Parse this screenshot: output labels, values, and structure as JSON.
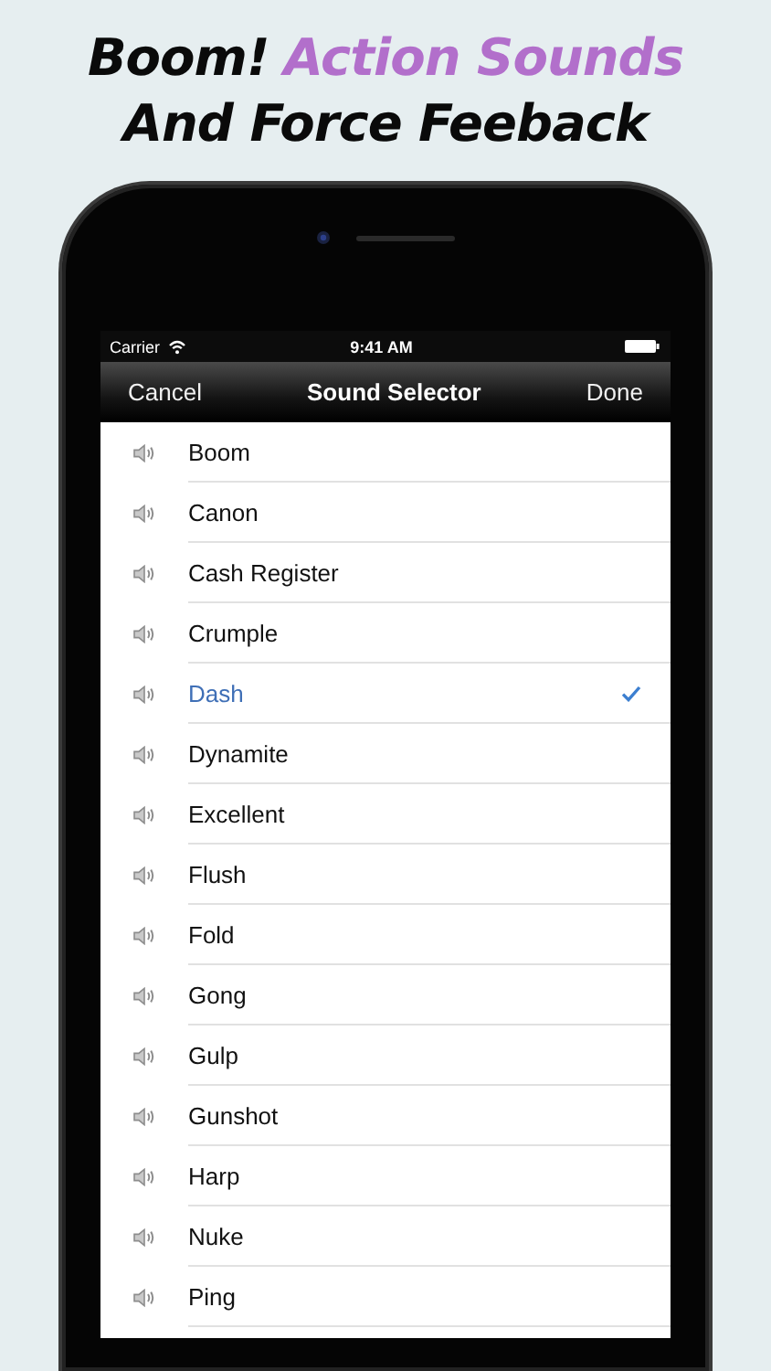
{
  "headline": [
    [
      {
        "text": "Boom!",
        "accent": false
      },
      {
        "text": "Action Sounds",
        "accent": true
      }
    ],
    [
      {
        "text": "And Force Feeback",
        "accent": false
      }
    ]
  ],
  "status_bar": {
    "carrier": "Carrier",
    "time": "9:41 AM"
  },
  "nav_bar": {
    "left": "Cancel",
    "title": "Sound Selector",
    "right": "Done"
  },
  "sounds": [
    {
      "name": "Boom",
      "selected": false
    },
    {
      "name": "Canon",
      "selected": false
    },
    {
      "name": "Cash Register",
      "selected": false
    },
    {
      "name": "Crumple",
      "selected": false
    },
    {
      "name": "Dash",
      "selected": true
    },
    {
      "name": "Dynamite",
      "selected": false
    },
    {
      "name": "Excellent",
      "selected": false
    },
    {
      "name": "Flush",
      "selected": false
    },
    {
      "name": "Fold",
      "selected": false
    },
    {
      "name": "Gong",
      "selected": false
    },
    {
      "name": "Gulp",
      "selected": false
    },
    {
      "name": "Gunshot",
      "selected": false
    },
    {
      "name": "Harp",
      "selected": false
    },
    {
      "name": "Nuke",
      "selected": false
    },
    {
      "name": "Ping",
      "selected": false
    }
  ]
}
